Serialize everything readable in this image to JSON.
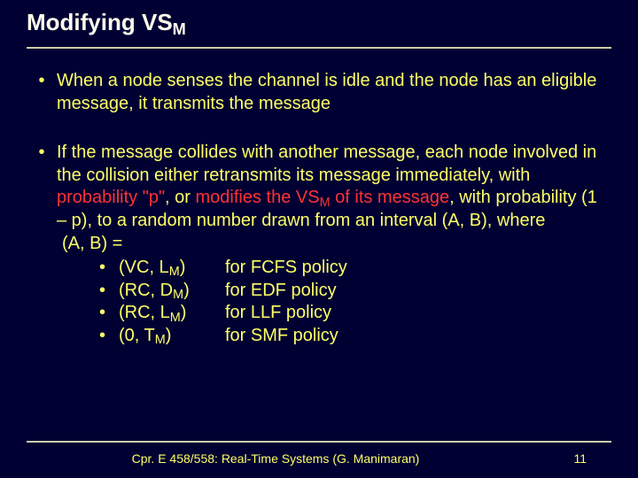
{
  "title_prefix": "Modifying VS",
  "title_sub": "M",
  "bullet_glyph": "•",
  "bullet1": "When a node senses the channel is idle and the node has an eligible message, it transmits the message",
  "b2": {
    "p1": "If the message collides with another message, each node involved in the collision either retransmits its message immediately, with ",
    "prob_p": "probability \"p\"",
    "p2": ", or ",
    "mod1": "modifies the VS",
    "mod_sub": "M",
    "mod2": " of its message",
    "p3": ", with probability (1 – p), to a random number drawn from an interval (A, B), where",
    "ab_line": "(A, B) ="
  },
  "policies": [
    {
      "open": "(VC, L",
      "sub": "M",
      "close": ")",
      "for": "for FCFS policy"
    },
    {
      "open": "(RC, D",
      "sub": "M",
      "close": ")",
      "for": "for EDF policy"
    },
    {
      "open": "(RC, L",
      "sub": "M",
      "close": ")",
      "for": " for LLF policy"
    },
    {
      "open": "(0, T",
      "sub": "M",
      "close": ")",
      "for": "for SMF policy"
    }
  ],
  "footer_text": "Cpr. E 458/558: Real-Time Systems (G. Manimaran)",
  "page_number": "11"
}
